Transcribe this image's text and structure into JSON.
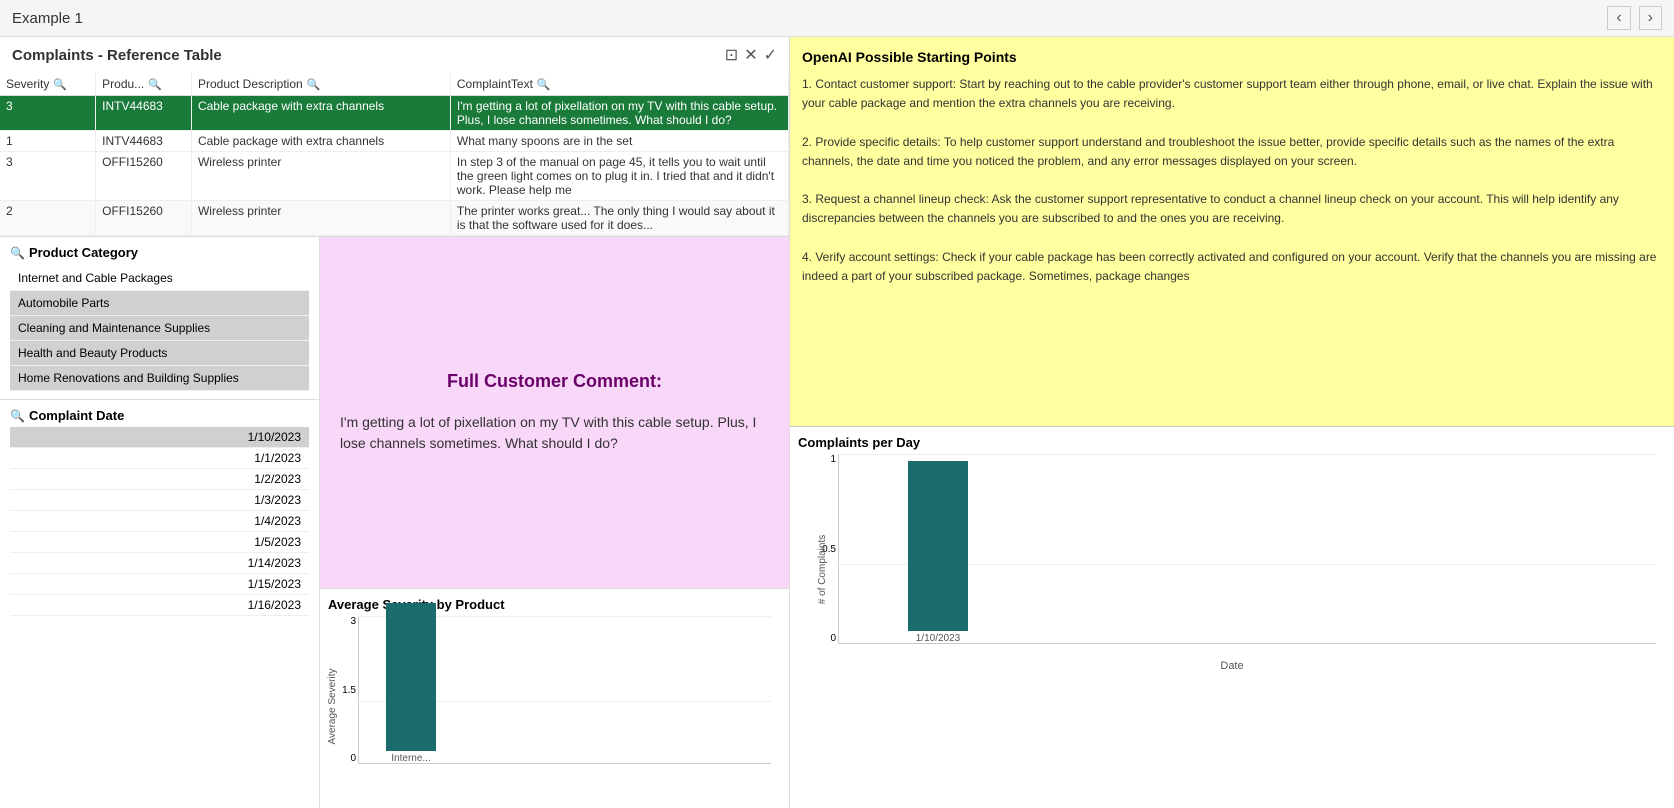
{
  "topBar": {
    "title": "Example 1",
    "prevBtn": "‹",
    "nextBtn": "›"
  },
  "refTable": {
    "title": "Complaints - Reference Table",
    "columns": [
      "Severity",
      "Produ...",
      "Product Description",
      "ComplaintText"
    ],
    "rows": [
      {
        "severity": "3",
        "product": "INTV44683",
        "description": "Cable package with extra channels",
        "complaint": "I'm getting a lot of pixellation on my TV with this cable setup. Plus, I lose channels sometimes. What should I do?",
        "highlighted": true
      },
      {
        "severity": "1",
        "product": "INTV44683",
        "description": "Cable package with extra channels",
        "complaint": "What many spoons are in the set",
        "highlighted": false
      },
      {
        "severity": "3",
        "product": "OFFI15260",
        "description": "Wireless printer",
        "complaint": "In step 3 of the manual on page 45, it tells you to wait until the green light comes on to plug it in. I tried that and it didn't work. Please help me",
        "highlighted": false
      },
      {
        "severity": "2",
        "product": "OFFI15260",
        "description": "Wireless printer",
        "complaint": "The printer works great... The only thing I would say about it is that the software used for it does...",
        "highlighted": false
      }
    ]
  },
  "productCategory": {
    "label": "Product Category",
    "items": [
      {
        "name": "Internet and Cable Packages",
        "active": true
      },
      {
        "name": "Automobile Parts",
        "active": false
      },
      {
        "name": "Cleaning and Maintenance Supplies",
        "active": false
      },
      {
        "name": "Health and Beauty Products",
        "active": false
      },
      {
        "name": "Home Renovations and Building Supplies",
        "active": false
      }
    ]
  },
  "complaintDate": {
    "label": "Complaint Date",
    "dates": [
      {
        "value": "1/10/2023",
        "selected": true
      },
      {
        "value": "1/1/2023",
        "selected": false
      },
      {
        "value": "1/2/2023",
        "selected": false
      },
      {
        "value": "1/3/2023",
        "selected": false
      },
      {
        "value": "1/4/2023",
        "selected": false
      },
      {
        "value": "1/5/2023",
        "selected": false
      },
      {
        "value": "1/14/2023",
        "selected": false
      },
      {
        "value": "1/15/2023",
        "selected": false
      },
      {
        "value": "1/16/2023",
        "selected": false
      }
    ]
  },
  "fullComment": {
    "title": "Full Customer Comment:",
    "text": "I'm getting a lot of pixellation on my TV with this cable setup. Plus, I lose channels sometimes. What should I do?"
  },
  "avgSeverityChart": {
    "title": "Average Severity by Product",
    "yLabel": "Average Severity",
    "xLabel": "Interne...",
    "yMax": 3,
    "yMid": 1.5,
    "yMin": 0,
    "barValue": 3,
    "barHeightPct": 100
  },
  "complaintsPerDay": {
    "title": "Complaints per Day",
    "yLabel": "# of Complaints",
    "xAxisLabel": "Date",
    "yMax": 1,
    "yMid": 0.5,
    "yMin": 0,
    "barDate": "1/10/2023",
    "barValue": 1,
    "barHeightPct": 100
  },
  "openAI": {
    "title": "OpenAI Possible Starting Points",
    "content": "1. Contact customer support: Start by reaching out to the cable provider's customer support team either through phone, email, or live chat. Explain the issue with your cable package and mention the extra channels you are receiving.\n\n2. Provide specific details: To help customer support understand and troubleshoot the issue better, provide specific details such as the names of the extra channels, the date and time you noticed the problem, and any error messages displayed on your screen.\n\n3. Request a channel lineup check: Ask the customer support representative to conduct a channel lineup check on your account. This will help identify any discrepancies between the channels you are subscribed to and the ones you are receiving.\n\n4. Verify account settings: Check if your cable package has been correctly activated and configured on your account. Verify that the channels you are missing are indeed a part of your subscribed package. Sometimes, package changes"
  }
}
